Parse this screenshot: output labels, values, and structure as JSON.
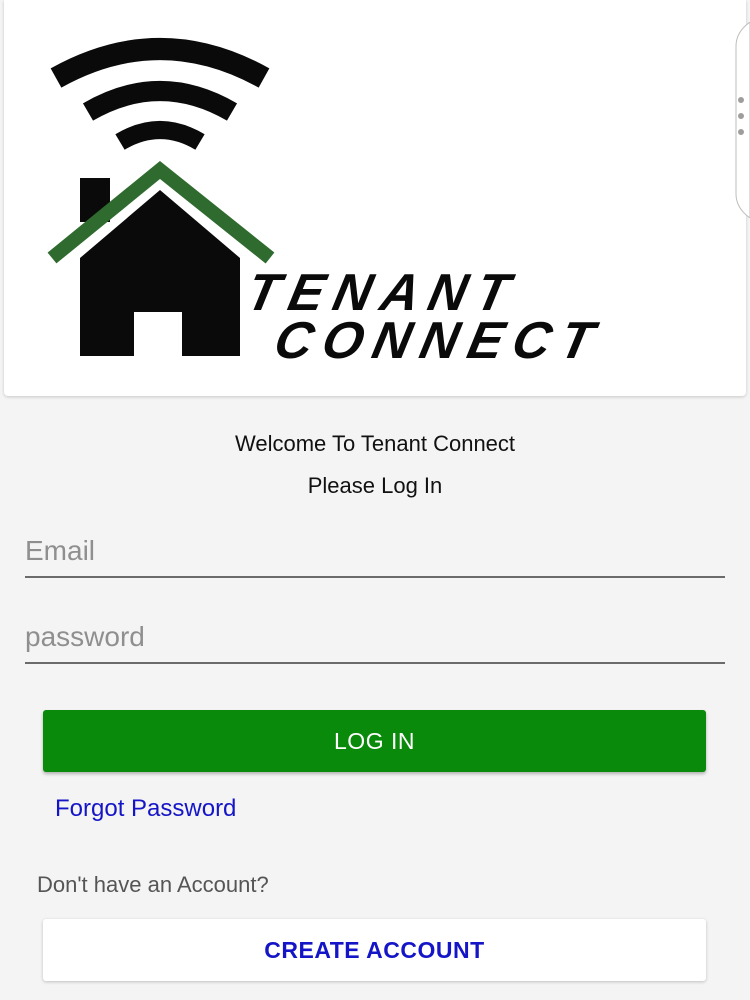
{
  "logo": {
    "alt_text": "TENANT CONNECT",
    "colors": {
      "house": "#0a0a0a",
      "roof_accent": "#2f6b2f",
      "signal": "#0a0a0a"
    }
  },
  "welcome": {
    "line1": "Welcome To Tenant Connect",
    "line2": "Please Log In"
  },
  "form": {
    "email_placeholder": "Email",
    "email_value": "",
    "password_placeholder": "password",
    "password_value": "",
    "login_label": "LOG IN",
    "forgot_label": "Forgot Password"
  },
  "signup": {
    "prompt": "Don't have an Account?",
    "create_label": "CREATE ACCOUNT"
  },
  "theme": {
    "primary_green": "#0a8a0a",
    "link_blue": "#1515c8",
    "background": "#f4f4f4"
  }
}
